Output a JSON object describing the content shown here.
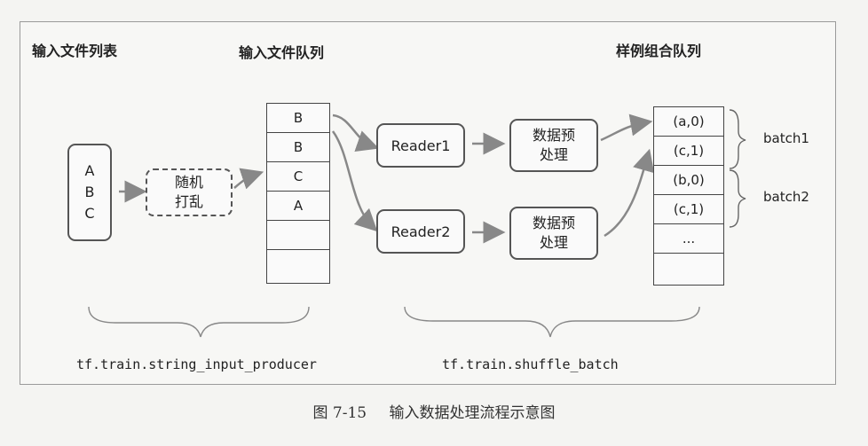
{
  "titles": {
    "file_list": "输入文件列表",
    "file_queue": "输入文件队列",
    "example_queue": "样例组合队列"
  },
  "file_list_items": [
    "A",
    "B",
    "C"
  ],
  "shuffle_box": {
    "line1": "随机",
    "line2": "打乱"
  },
  "file_queue_cells": [
    "B",
    "B",
    "C",
    "A",
    "",
    ""
  ],
  "readers": [
    "Reader1",
    "Reader2"
  ],
  "preprocess": {
    "line1": "数据预",
    "line2": "处理"
  },
  "example_queue_cells": [
    "(a,0)",
    "(c,1)",
    "(b,0)",
    "(c,1)",
    "...",
    ""
  ],
  "batches": [
    "batch1",
    "batch2"
  ],
  "functions": {
    "producer": "tf.train.string_input_producer",
    "shuffle": "tf.train.shuffle_batch"
  },
  "caption": {
    "number": "图 7-15",
    "text": "输入数据处理流程示意图"
  }
}
